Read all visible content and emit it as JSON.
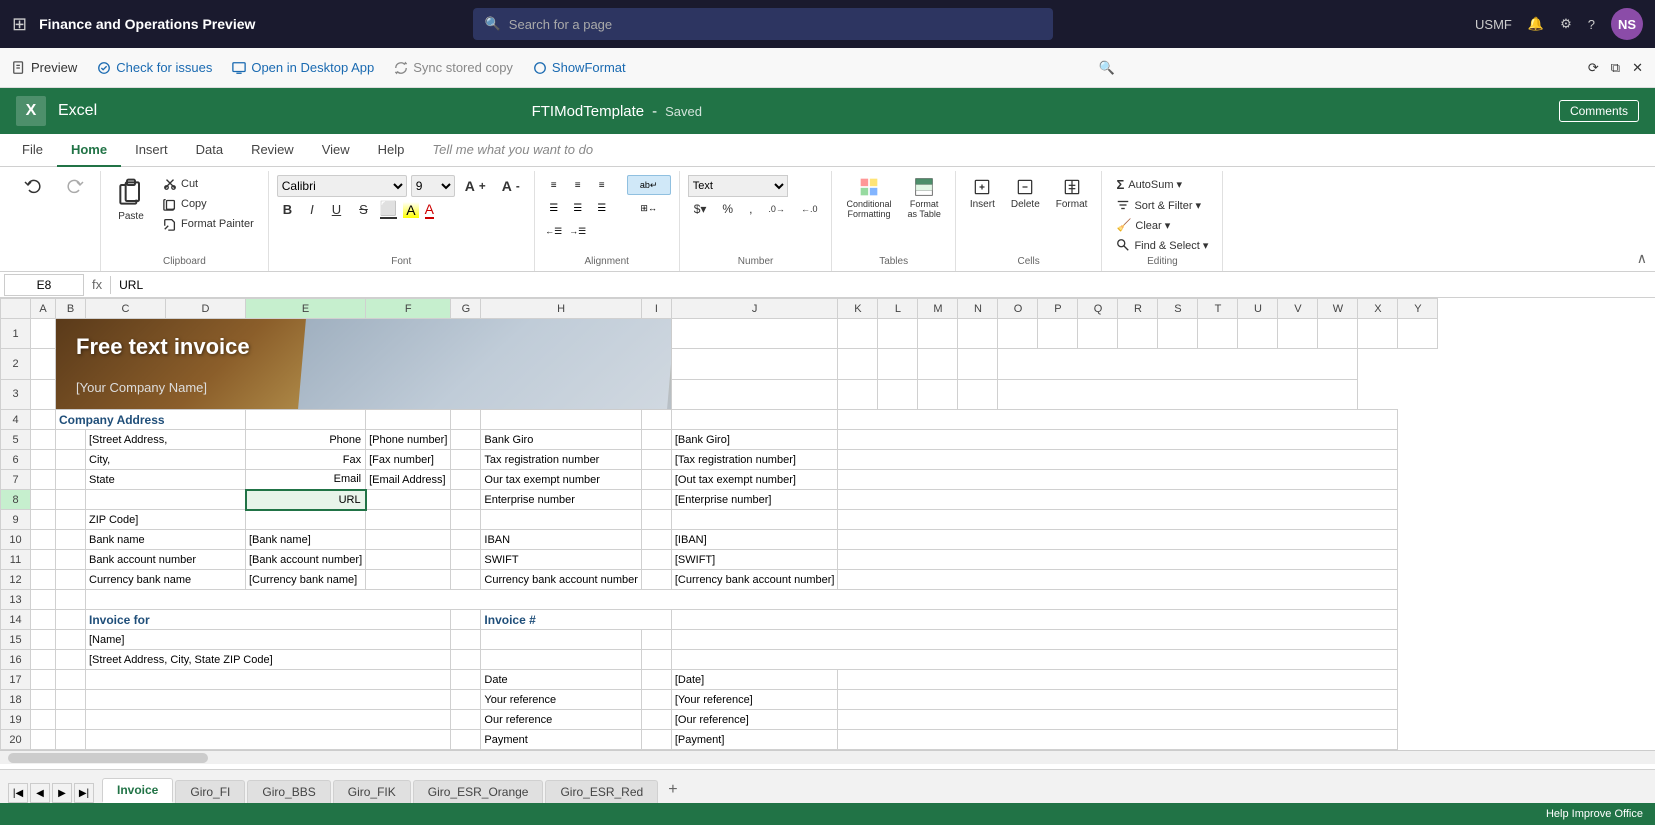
{
  "topNav": {
    "appTitle": "Finance and Operations Preview",
    "searchPlaceholder": "Search for a page",
    "userCode": "USMF",
    "userInitials": "NS"
  },
  "secondBar": {
    "preview": "Preview",
    "checkForIssues": "Check for issues",
    "openInDesktopApp": "Open in Desktop App",
    "syncStoredCopy": "Sync stored copy",
    "showFormat": "ShowFormat"
  },
  "excelHeader": {
    "appName": "Excel",
    "logoLetter": "X",
    "fileName": "FTIModTemplate",
    "separator": "-",
    "savedStatus": "Saved",
    "commentsBtn": "Comments"
  },
  "ribbonTabs": [
    "File",
    "Home",
    "Insert",
    "Data",
    "Review",
    "View",
    "Help",
    "Tell me what you want to do"
  ],
  "activeTab": "Home",
  "ribbon": {
    "undo": "Undo",
    "redo": "Redo",
    "clipboard": "Clipboard",
    "paste": "Paste",
    "cut": "Cut",
    "copy": "Copy",
    "formatPainter": "Format Painter",
    "fontName": "Calibri",
    "fontSize": "9",
    "fontGroup": "Font",
    "bold": "B",
    "italic": "I",
    "underline": "U",
    "strikethrough": "S",
    "alignment": "Alignment",
    "numberFormat": "Text",
    "numberGroup": "Number",
    "conditionalFormatting": "Conditional Formatting",
    "formatAsTable": "Format as Table",
    "insert": "Insert",
    "delete": "Delete",
    "format": "Format",
    "autoSum": "AutoSum",
    "sortFilter": "Sort & Filter",
    "findSelect": "Find & Select",
    "clear": "Clear",
    "editing": "Editing",
    "cells": "Cells",
    "tables": "Tables"
  },
  "formulaBar": {
    "cellRef": "E8",
    "formula": "URL"
  },
  "columns": [
    "",
    "A",
    "B",
    "C",
    "D",
    "E",
    "F",
    "G",
    "H",
    "I",
    "J",
    "K",
    "L",
    "M",
    "N",
    "O",
    "P",
    "Q",
    "R",
    "S",
    "T",
    "U",
    "V",
    "W",
    "X",
    "Y"
  ],
  "rows": {
    "1": {
      "cells": {
        "B-L": "invoice_header",
        "type": "header"
      }
    },
    "2": {
      "cells": {
        "B": "",
        "note": "company name row"
      }
    },
    "3": {
      "cells": {}
    },
    "4": {
      "cells": {
        "B": "Company Address",
        "bold": true,
        "color": "blue"
      }
    },
    "5": {
      "cells": {
        "C": "[Street Address,",
        "E": "Phone",
        "F": "[Phone number]",
        "H": "Bank Giro",
        "J": "[Bank Giro]"
      }
    },
    "6": {
      "cells": {
        "C": "City,",
        "E": "Fax",
        "F": "[Fax number]",
        "H": "Tax registration number",
        "J": "[Tax registration number]"
      }
    },
    "7": {
      "cells": {
        "C": "State",
        "E": "Email",
        "F": "[Email Address]",
        "H": "Our tax exempt number",
        "J": "[Out tax exempt number]"
      }
    },
    "8": {
      "cells": {
        "E": "URL",
        "H": "Enterprise number",
        "J": "[Enterprise number]"
      },
      "selected": true
    },
    "9": {
      "cells": {
        "C": "ZIP Code]"
      }
    },
    "10": {
      "cells": {
        "C": "Bank name",
        "E": "[Bank name]",
        "H": "IBAN",
        "J": "[IBAN]"
      }
    },
    "11": {
      "cells": {
        "C": "Bank account number",
        "E": "[Bank account number]",
        "H": "SWIFT",
        "J": "[SWIFT]"
      }
    },
    "12": {
      "cells": {
        "C": "Currency bank name",
        "E": "[Currency bank name]",
        "H": "Currency bank account number",
        "J": "[Currency bank account number]"
      }
    },
    "13": {
      "cells": {}
    },
    "14": {
      "cells": {
        "B": "Invoice for",
        "bold": true,
        "color": "blue",
        "H": "Invoice #",
        "bold2": true,
        "color2": "blue"
      }
    },
    "15": {
      "cells": {
        "C": "[Name]"
      }
    },
    "16": {
      "cells": {
        "C": "[Street Address, City, State ZIP Code]"
      }
    },
    "17": {
      "cells": {
        "H": "Date",
        "J": "[Date]"
      }
    },
    "18": {
      "cells": {
        "H": "Your reference",
        "J": "[Your reference]"
      }
    },
    "19": {
      "cells": {
        "H": "Our reference",
        "J": "[Our reference]"
      }
    },
    "20": {
      "cells": {
        "H": "Payment",
        "J": "[Payment]"
      }
    }
  },
  "sheetTabs": [
    "Invoice",
    "Giro_FI",
    "Giro_BBS",
    "Giro_FIK",
    "Giro_ESR_Orange",
    "Giro_ESR_Red"
  ],
  "activeSheet": "Invoice",
  "statusBar": {
    "text": "Help Improve Office"
  }
}
